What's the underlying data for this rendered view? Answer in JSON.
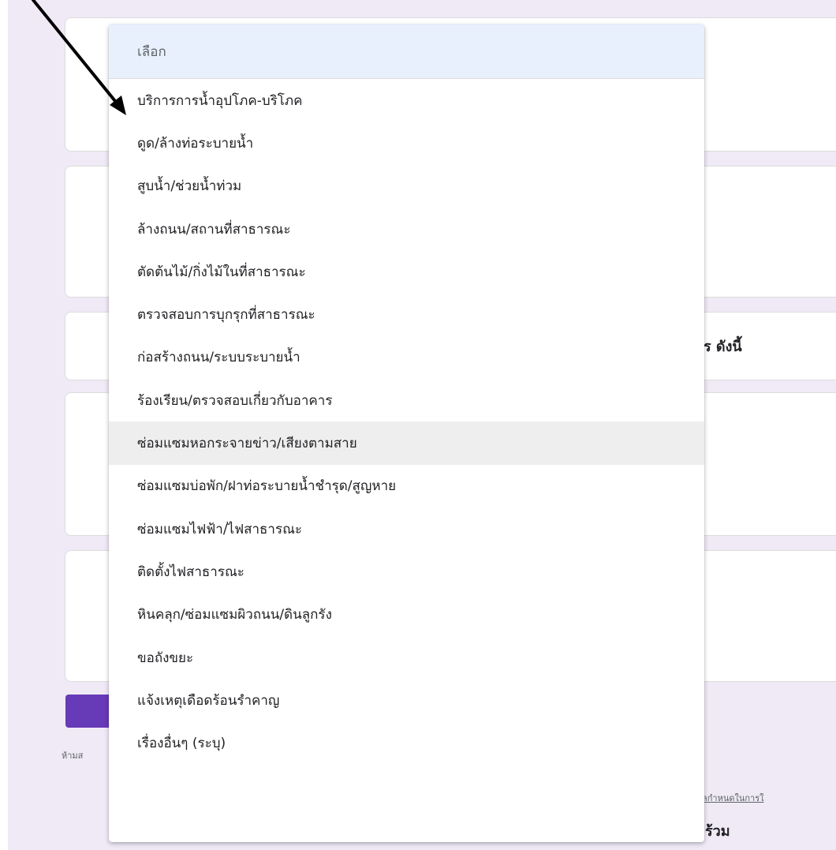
{
  "dropdown": {
    "placeholder": "เลือก",
    "options": [
      "บริการการน้ำอุปโภค-บริโภค",
      "ดูด/ล้างท่อระบายน้ำ",
      "สูบน้ำ/ช่วยน้ำท่วม",
      "ล้างถนน/สถานที่สาธารณะ",
      "ตัดต้นไม้/กิ่งไม้ในที่สาธารณะ",
      "ตรวจสอบการบุกรุกที่สาธารณะ",
      "ก่อสร้างถนน/ระบบระบายน้ำ",
      "ร้องเรียน/ตรวจสอบเกี่ยวกับอาคาร",
      "ซ่อมแซมหอกระจายข่าว/เสียงตามสาย",
      "ซ่อมแซมบ่อพัก/ฝาท่อระบายน้ำชำรุด/สูญหาย",
      "ซ่อมแซมไฟฟ้า/ไฟสาธารณะ",
      "ติดตั้งไฟสาธารณะ",
      "หินคลุก/ซ่อมแซมผิวถนน/ดินลูกรัง",
      "ขอถังขยะ",
      "แจ้งเหตุเดือดร้อนรำคาญ",
      "เรื่องอื่นๆ (ระบุ)"
    ]
  },
  "background": {
    "card3_text": "ร ดังนี้",
    "footer_left": "ห้ามส",
    "footer_link": "ลกำหนดในการใ",
    "footer_bottom": "ร้วม"
  },
  "colors": {
    "page_bg": "#efeaf6",
    "accent": "#673ab7",
    "placeholder_bg": "#e8f0fe",
    "hover_bg": "#eeeeee"
  }
}
